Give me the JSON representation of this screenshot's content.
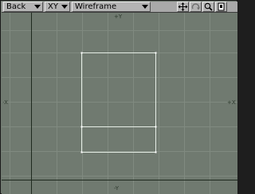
{
  "toolbar": {
    "view_label": "Back",
    "axis_label": "XY",
    "mode_label": "Wireframe",
    "icons": [
      "move-icon",
      "rotate-icon",
      "zoom-icon",
      "maximize-icon"
    ]
  },
  "viewport": {
    "label_top": "+Y",
    "label_left": "-X",
    "label_right": "+X",
    "label_bottom": "-Y",
    "colors": {
      "background": "#707a70",
      "grid_line": "#808a80",
      "axis_line": "#1f2a1f",
      "wireframe": "#e6eee6",
      "toolbar": "#b4b4b4"
    }
  }
}
